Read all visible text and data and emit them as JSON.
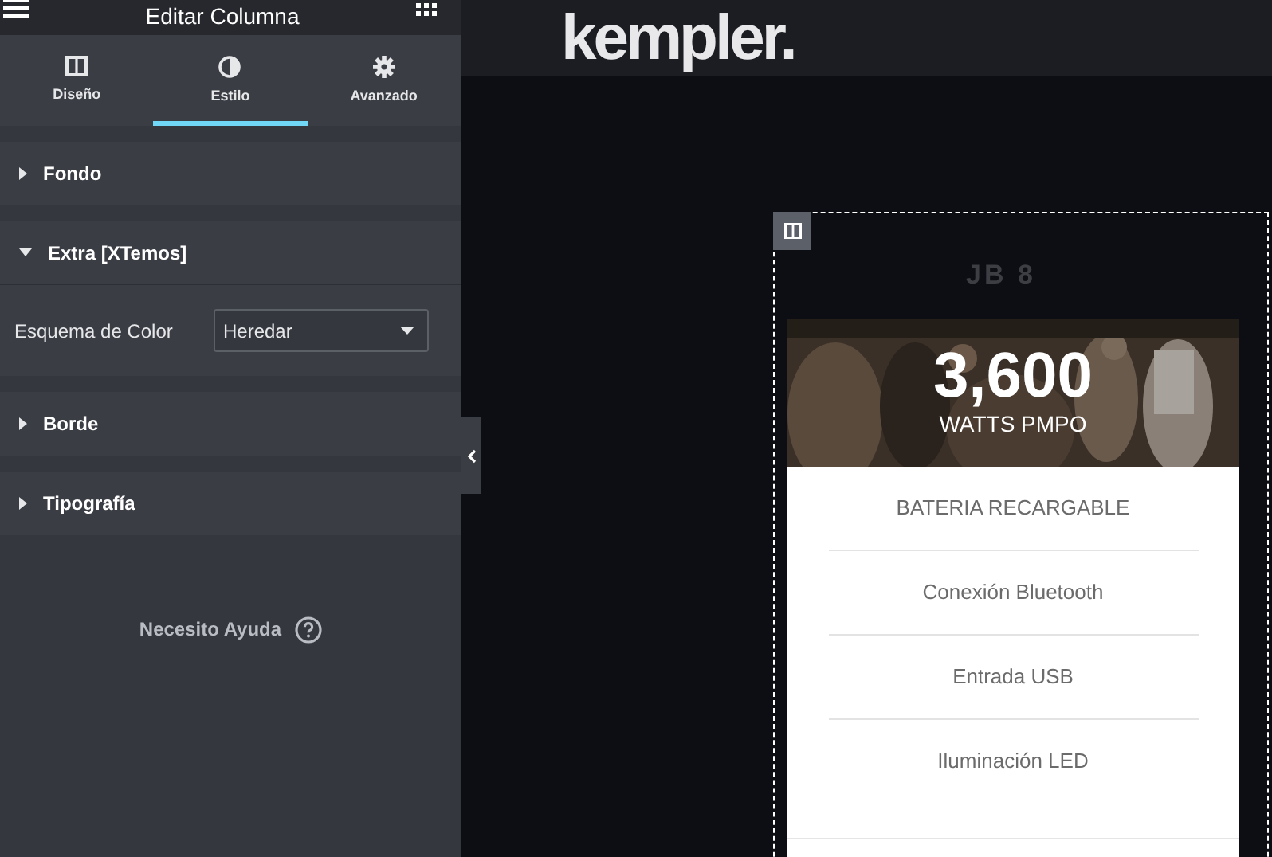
{
  "panel": {
    "title": "Editar Columna",
    "tabs": [
      {
        "label": "Diseño",
        "kind": "columns",
        "selected": false
      },
      {
        "label": "Estilo",
        "kind": "contrast",
        "selected": true
      },
      {
        "label": "Avanzado",
        "kind": "gear",
        "selected": false
      }
    ],
    "sections": [
      {
        "title": "Fondo",
        "expanded": false
      },
      {
        "title": "Extra [XTemos]",
        "expanded": true,
        "field": {
          "label": "Esquema de Color",
          "value": "Heredar"
        }
      },
      {
        "title": "Borde",
        "expanded": false
      },
      {
        "title": "Tipografía",
        "expanded": false
      }
    ],
    "help": "Necesito Ayuda"
  },
  "site": {
    "logo": "kempler.",
    "product_caption": "JB 8",
    "stat": {
      "value": "3,600",
      "unit": "WATTS PMPO"
    },
    "features": [
      "BATERIA RECARGABLE",
      "Conexión Bluetooth",
      "Entrada USB",
      "Iluminación LED"
    ]
  }
}
